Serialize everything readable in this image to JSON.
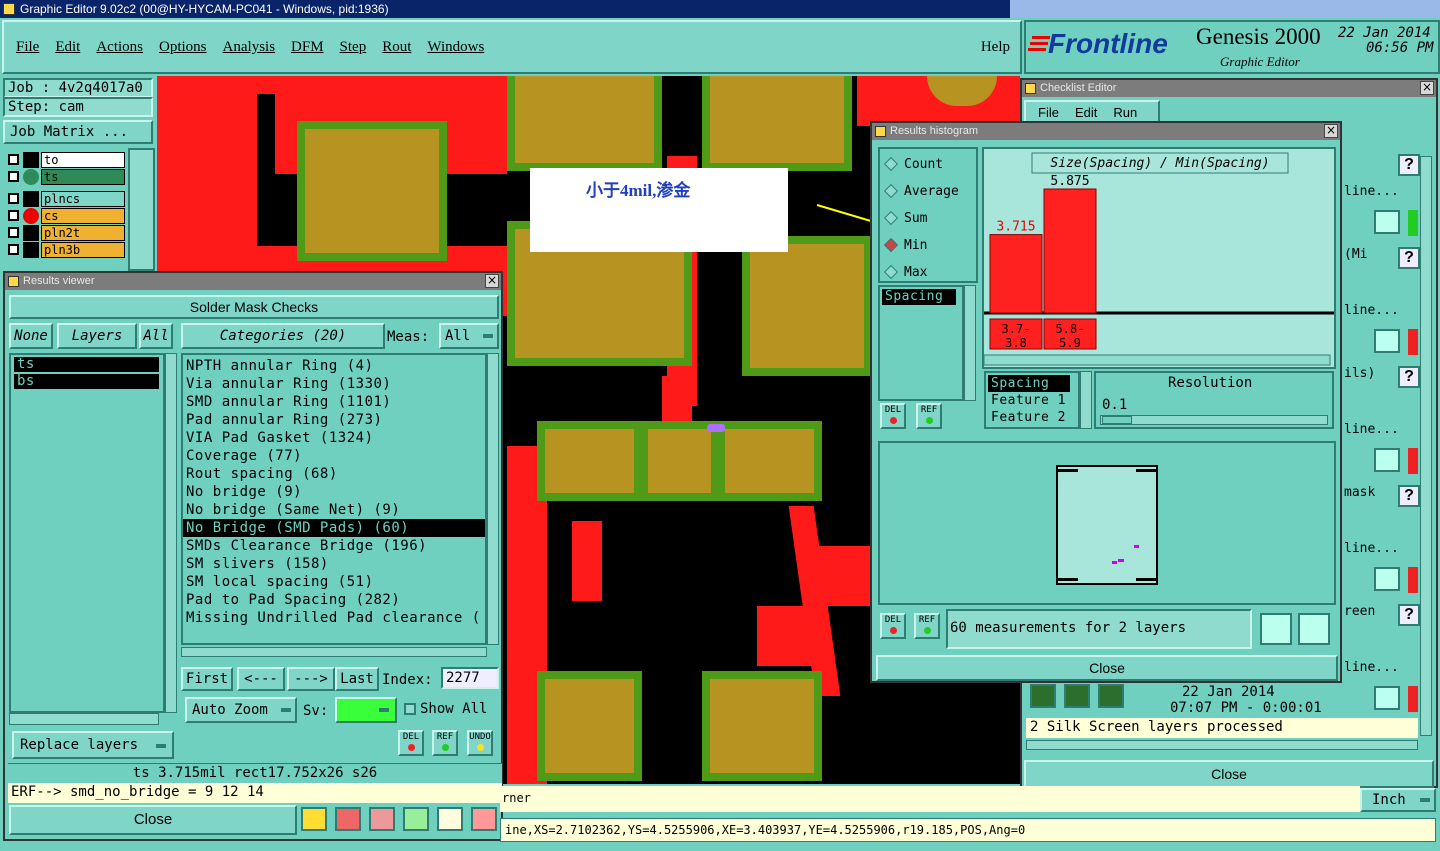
{
  "app": {
    "window_title": "Graphic Editor 9.02c2 (00@HY-HYCAM-PC041 - Windows, pid:1936)",
    "menu": [
      "File",
      "Edit",
      "Actions",
      "Options",
      "Analysis",
      "DFM",
      "Step",
      "Rout",
      "Windows"
    ],
    "help": "Help",
    "brand": "Frontline",
    "product": "Genesis 2000",
    "product_sub": "Graphic Editor",
    "date": "22 Jan 2014",
    "time": "06:56 PM"
  },
  "job": {
    "job_label": "Job : 4v2q4017a0",
    "step_label": "Step: cam",
    "matrix_button": "Job Matrix ...",
    "layers": [
      {
        "name": "to",
        "color": "#ffffff"
      },
      {
        "name": "ts",
        "color": "#2e8b57"
      },
      {
        "name": "plncs",
        "color": "#7fd6c8"
      },
      {
        "name": "cs",
        "color": "#f0b030"
      },
      {
        "name": "pln2t",
        "color": "#f0b030"
      },
      {
        "name": "pln3b",
        "color": "#f0b030"
      }
    ]
  },
  "annotation": {
    "text": "小于4mil,渗金"
  },
  "results_viewer": {
    "title": "Results viewer",
    "header": "Solder Mask Checks",
    "none_btn": "None",
    "layers_btn": "Layers",
    "all_btn": "All",
    "categories_btn": "Categories (20)",
    "meas_label": "Meas:",
    "meas_value": "All",
    "layer_list": [
      "ts",
      "bs"
    ],
    "categories": [
      "NPTH annular Ring (4)",
      "Via annular Ring (1330)",
      "SMD annular Ring (1101)",
      "Pad annular Ring (273)",
      "VIA Pad Gasket (1324)",
      "Coverage (77)",
      "Rout spacing (68)",
      "No bridge (9)",
      "No bridge (Same Net) (9)",
      "No Bridge (SMD Pads) (60)",
      "SMDs Clearance Bridge (196)",
      "SM slivers (158)",
      "SM local spacing (51)",
      "Pad to Pad Spacing (282)",
      "Missing Undrilled Pad clearance ("
    ],
    "selected_index": 9,
    "first": "First",
    "prev": "<---",
    "next": "--->",
    "last": "Last",
    "index_label": "Index:",
    "index_value": "2277",
    "auto_zoom": "Auto Zoom",
    "sv_label": "Sv:",
    "show_all": "Show All",
    "replace_layers": "Replace layers",
    "status": "ts 3.715mil  rect17.752x26  s26",
    "erf": "ERF--> smd_no_bridge = 9 12 14",
    "close": "Close",
    "del": "DEL",
    "ref": "REF",
    "undo": "UNDO"
  },
  "histogram": {
    "title": "Results histogram",
    "options": [
      "Count",
      "Average",
      "Sum",
      "Min",
      "Max"
    ],
    "selected_option": "Min",
    "measure_list": [
      "Spacing"
    ],
    "chart_title": "Size(Spacing) / Min(Spacing)",
    "resolution_label": "Resolution",
    "resolution_value": "0.1",
    "attr_list": [
      "Spacing",
      "Feature 1",
      "Feature 2"
    ],
    "measurements": "60 measurements for 2 layers",
    "close": "Close",
    "del": "DEL",
    "ref": "REF"
  },
  "chart_data": {
    "type": "bar",
    "title": "Size(Spacing) / Min(Spacing)",
    "categories": [
      "3.7-3.8",
      "5.8-5.9"
    ],
    "values": [
      3.715,
      5.875
    ],
    "value_labels": [
      "3.715",
      "5.875"
    ],
    "bar_color": "#ff2020"
  },
  "checklist": {
    "title": "Checklist Editor",
    "menu": [
      "File",
      "Edit",
      "Run"
    ],
    "rows": [
      "line...",
      "line...",
      "line...",
      "line...",
      "line..."
    ],
    "side_labels": [
      "(Mi",
      "ils)",
      "mask",
      "reen"
    ],
    "date": "22 Jan 2014",
    "time": "07:07 PM - 0:00:01",
    "message": "2 Silk Screen layers processed",
    "close": "Close"
  },
  "bottom": {
    "corner_text": "rner",
    "units": "Inch",
    "status_line": "ine,XS=2.7102362,YS=4.5255906,XE=3.403937,YE=4.5255906,r19.185,POS,Ang=0"
  }
}
